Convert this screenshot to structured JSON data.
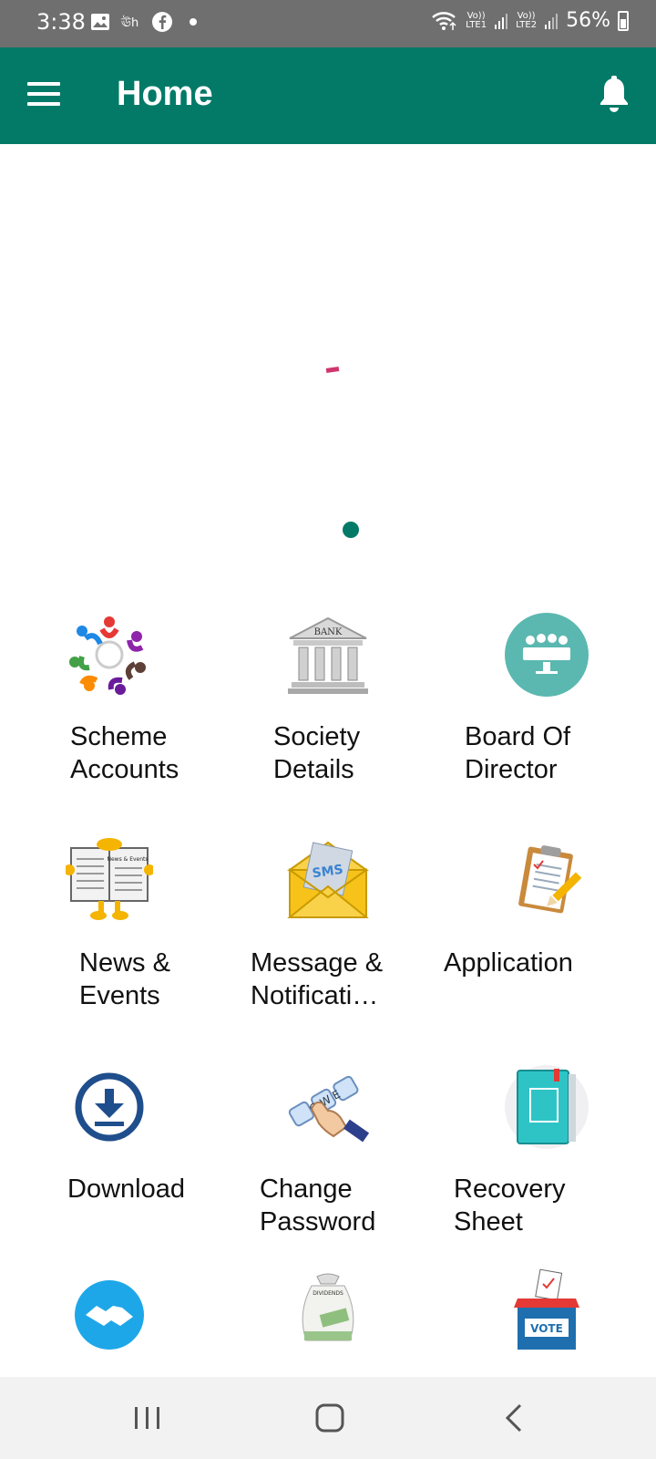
{
  "status_bar": {
    "time": "3:38",
    "sim1_top": "Vo))",
    "sim1_bottom": "LTE1",
    "sim2_top": "Vo))",
    "sim2_bottom": "LTE2",
    "battery": "56%"
  },
  "app_bar": {
    "title": "Home"
  },
  "carousel": {
    "total_pages": 1,
    "active_page": 1
  },
  "menu": {
    "items": [
      {
        "label": "Scheme\nAccounts",
        "icon": "team-circle-icon"
      },
      {
        "label": "Society\nDetails",
        "icon": "bank-building-icon"
      },
      {
        "label": "Board Of\nDirector",
        "icon": "meeting-icon"
      },
      {
        "label": "News &\nEvents",
        "icon": "newspaper-icon"
      },
      {
        "label": "Message &\nNotificati…",
        "icon": "sms-envelope-icon"
      },
      {
        "label": "Application",
        "icon": "clipboard-pencil-icon"
      },
      {
        "label": "Download",
        "icon": "download-icon"
      },
      {
        "label": "Change\nPassword",
        "icon": "keyboard-hand-icon"
      },
      {
        "label": "Recovery\nSheet",
        "icon": "book-icon"
      },
      {
        "label": "",
        "icon": "handshake-icon"
      },
      {
        "label": "",
        "icon": "dividend-moneybag-icon"
      },
      {
        "label": "",
        "icon": "vote-box-icon"
      }
    ],
    "icon_text": {
      "bank": "BANK",
      "sms": "SMS",
      "news": "News & Events",
      "keys": "Q W E",
      "dividends": "DIVIDENDS",
      "vote": "VOTE"
    }
  },
  "colors": {
    "primary": "#037a68",
    "status_bar": "#6f6f6f",
    "accent": "#d1356e",
    "nav_bar": "#f2f2f2"
  }
}
